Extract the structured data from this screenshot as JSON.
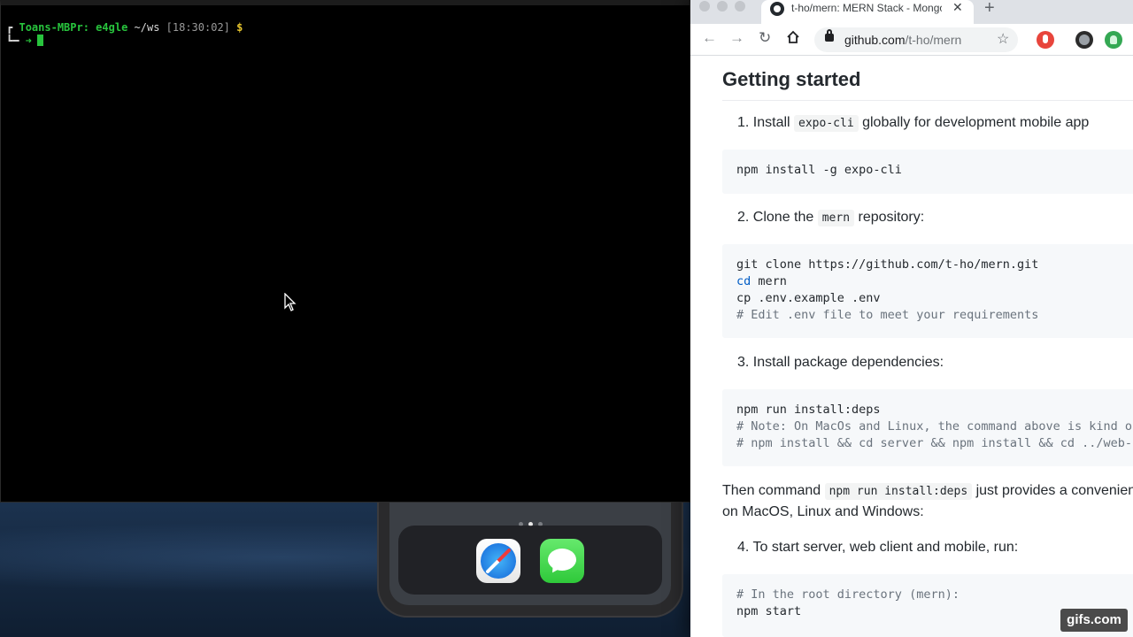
{
  "terminal": {
    "corner": "┏",
    "host": "Toans-MBPr:",
    "user": " e4gle",
    "path": " ~/ws",
    "time": " [18:30:02]",
    "dollar": " $",
    "corner2": "┗━",
    "arrow": " ➜",
    "prompt_color": "#28c43d"
  },
  "phone": {
    "dock_apps": [
      "safari-icon",
      "messages-icon"
    ]
  },
  "browser": {
    "tab_title": "t-ho/mern: MERN Stack - MongoDB",
    "tab_close": "✕",
    "new_tab": "+",
    "url_host": "github.com",
    "url_path": "/t-ho/mern",
    "nav": {
      "back": "←",
      "forward": "→",
      "reload": "↻",
      "home": "⌂",
      "star": "☆"
    }
  },
  "readme": {
    "heading": "Getting started",
    "step1_pre": "1. Install ",
    "step1_code": "expo-cli",
    "step1_post": " globally for development mobile app",
    "code1": "npm install -g expo-cli",
    "step2_pre": "2. Clone the ",
    "step2_code": "mern",
    "step2_post": " repository:",
    "code2_l1": "git clone https://github.com/t-ho/mern.git",
    "code2_l2_kw": "cd",
    "code2_l2_rest": " mern",
    "code2_l3": "cp .env.example .env",
    "code2_l4": "# Edit .env file to meet your requirements",
    "step3": "3. Install package dependencies:",
    "code3_l1": "npm run install:deps",
    "code3_l2": "# Note: On MacOs and Linux, the command above is kind of",
    "code3_l3": "# npm install && cd server && npm install && cd ../web-",
    "para_pre": "Then command ",
    "para_code": "npm run install:deps",
    "para_post": " just provides a convenien",
    "para_line2": "on MacOS, Linux and Windows:",
    "step4": "4. To start server, web client and mobile, run:",
    "code4_l1": "# In the root directory (mern):",
    "code4_l2": "npm start"
  },
  "watermark": "gifs.com"
}
